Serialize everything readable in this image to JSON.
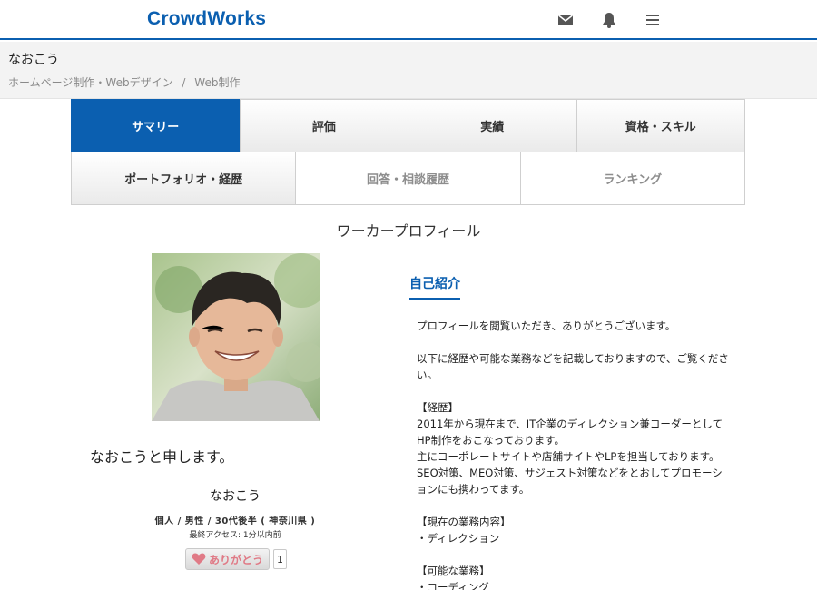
{
  "header": {
    "logo": "CrowdWorks",
    "icons": [
      "mail-icon",
      "bell-icon",
      "menu-icon"
    ],
    "accent_color": "#0b5fb0"
  },
  "crumbband": {
    "user_name": "なおこう",
    "breadcrumb": [
      "ホームページ制作・Webデザイン",
      "/",
      "Web制作"
    ]
  },
  "tabs": {
    "row1": [
      "サマリー",
      "評価",
      "実績",
      "資格・スキル"
    ],
    "row2": [
      "ポートフォリオ・経歴",
      "回答・相談履歴",
      "ランキング"
    ],
    "active": "サマリー"
  },
  "profile": {
    "page_title": "ワーカープロフィール",
    "intro": "なおこうと申します。",
    "name": "なおこう",
    "attributes": "個人 / 男性 / 30代後半 ( 神奈川県 )",
    "last_access": "最終アクセス: 1分以内前",
    "thanks_label": "ありがとう",
    "thanks_count": "1"
  },
  "self_intro": {
    "heading": "自己紹介",
    "lines": [
      "プロフィールを閲覧いただき、ありがとうございます。",
      "",
      "以下に経歴や可能な業務などを記載しておりますので、ご覧ください。",
      "",
      "【経歴】",
      "2011年から現在まで、IT企業のディレクション兼コーダーとしてHP制作をおこなっております。",
      "主にコーポレートサイトや店舗サイトやLPを担当しております。",
      "SEO対策、MEO対策、サジェスト対策などをとおしてプロモーションにも携わってます。",
      "",
      "【現在の業務内容】",
      "・ディレクション",
      "",
      "【可能な業務】",
      "・コーディング"
    ]
  }
}
